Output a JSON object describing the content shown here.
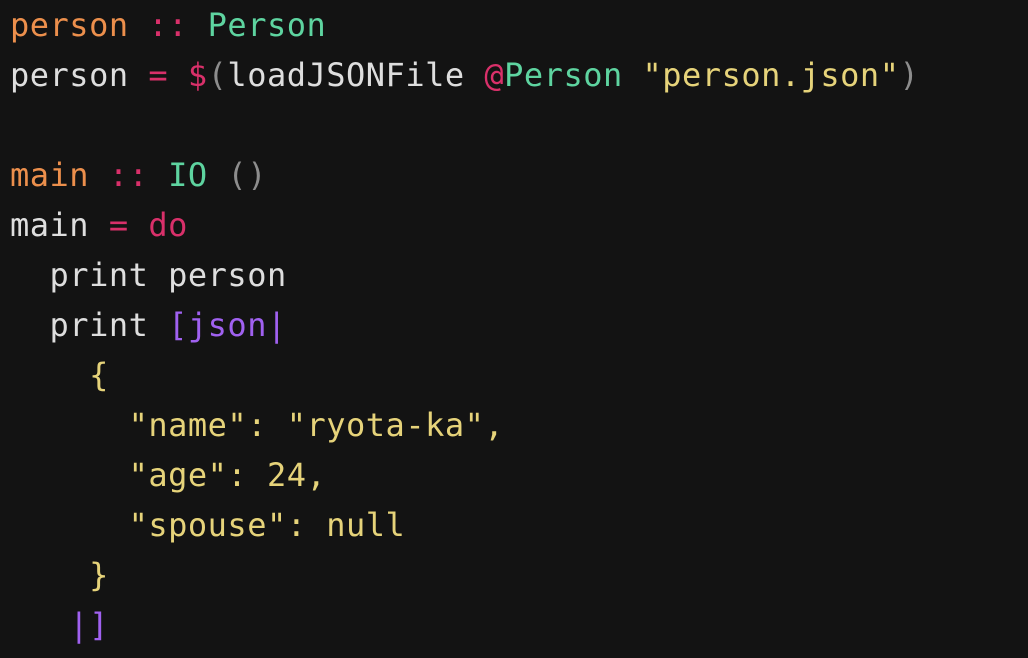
{
  "theme": {
    "background": "#131313",
    "colors": {
      "fn": "#ec8f4c",
      "op": "#d9306a",
      "type": "#5ed4a0",
      "plain": "#dedede",
      "string": "#e6d37a",
      "dim": "#8d8d8d",
      "quasi": "#a061f0"
    }
  },
  "code": {
    "lines": [
      [
        {
          "t": "person",
          "c": "fn"
        },
        {
          "t": " :: ",
          "c": "op"
        },
        {
          "t": "Person",
          "c": "type"
        }
      ],
      [
        {
          "t": "person",
          "c": "plain"
        },
        {
          "t": " = ",
          "c": "op"
        },
        {
          "t": "$",
          "c": "op"
        },
        {
          "t": "(",
          "c": "dim"
        },
        {
          "t": "loadJSONFile",
          "c": "plain"
        },
        {
          "t": " ",
          "c": "plain"
        },
        {
          "t": "@",
          "c": "op"
        },
        {
          "t": "Person",
          "c": "type"
        },
        {
          "t": " ",
          "c": "plain"
        },
        {
          "t": "\"person.json\"",
          "c": "string"
        },
        {
          "t": ")",
          "c": "dim"
        }
      ],
      [],
      [
        {
          "t": "main",
          "c": "fn"
        },
        {
          "t": " :: ",
          "c": "op"
        },
        {
          "t": "IO",
          "c": "type"
        },
        {
          "t": " ",
          "c": "plain"
        },
        {
          "t": "()",
          "c": "dim"
        }
      ],
      [
        {
          "t": "main",
          "c": "plain"
        },
        {
          "t": " = ",
          "c": "op"
        },
        {
          "t": "do",
          "c": "op"
        }
      ],
      [
        {
          "t": "  print person",
          "c": "plain"
        }
      ],
      [
        {
          "t": "  print ",
          "c": "plain"
        },
        {
          "t": "[json|",
          "c": "quasi"
        }
      ],
      [
        {
          "t": "    {",
          "c": "string"
        }
      ],
      [
        {
          "t": "      \"name\": \"ryota-ka\",",
          "c": "string"
        }
      ],
      [
        {
          "t": "      \"age\": 24,",
          "c": "string"
        }
      ],
      [
        {
          "t": "      \"spouse\": null",
          "c": "string"
        }
      ],
      [
        {
          "t": "    }",
          "c": "string"
        }
      ],
      [
        {
          "t": "   |]",
          "c": "quasi"
        }
      ]
    ]
  }
}
